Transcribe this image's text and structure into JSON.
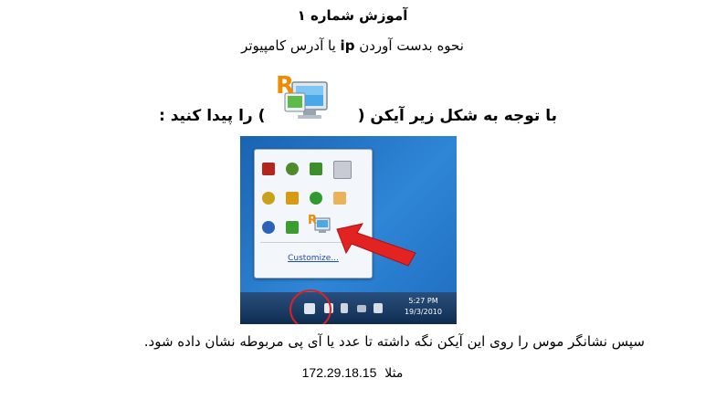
{
  "title": "آموزش شماره ۱",
  "subtitle": {
    "before": "نحوه بدست آوردن ",
    "keyword": "ip",
    "after": " یا آدرس کامپیوتر"
  },
  "instruction": {
    "right_part": "با توجه به شکل زیر آیکن (",
    "left_part": ") را پیدا کنید :"
  },
  "screenshot": {
    "customize_link": "Customize...",
    "clock_time": "5:27 PM",
    "clock_date": "19/3/2010"
  },
  "description": "سپس نشانگر موس را روی این آیکن نگه داشته تا عدد یا آی پی مربوطه نشان داده شود.",
  "example": {
    "label": "مثلا",
    "ip": "172.29.18.15"
  },
  "colors": {
    "highlight_red": "#e02020",
    "desktop_blue": "#1d6fc0",
    "icon_orange": "#f08a00"
  },
  "icons": [
    "remote-desktop-icon",
    "tray-popup",
    "red-arrow",
    "notification-circle"
  ]
}
